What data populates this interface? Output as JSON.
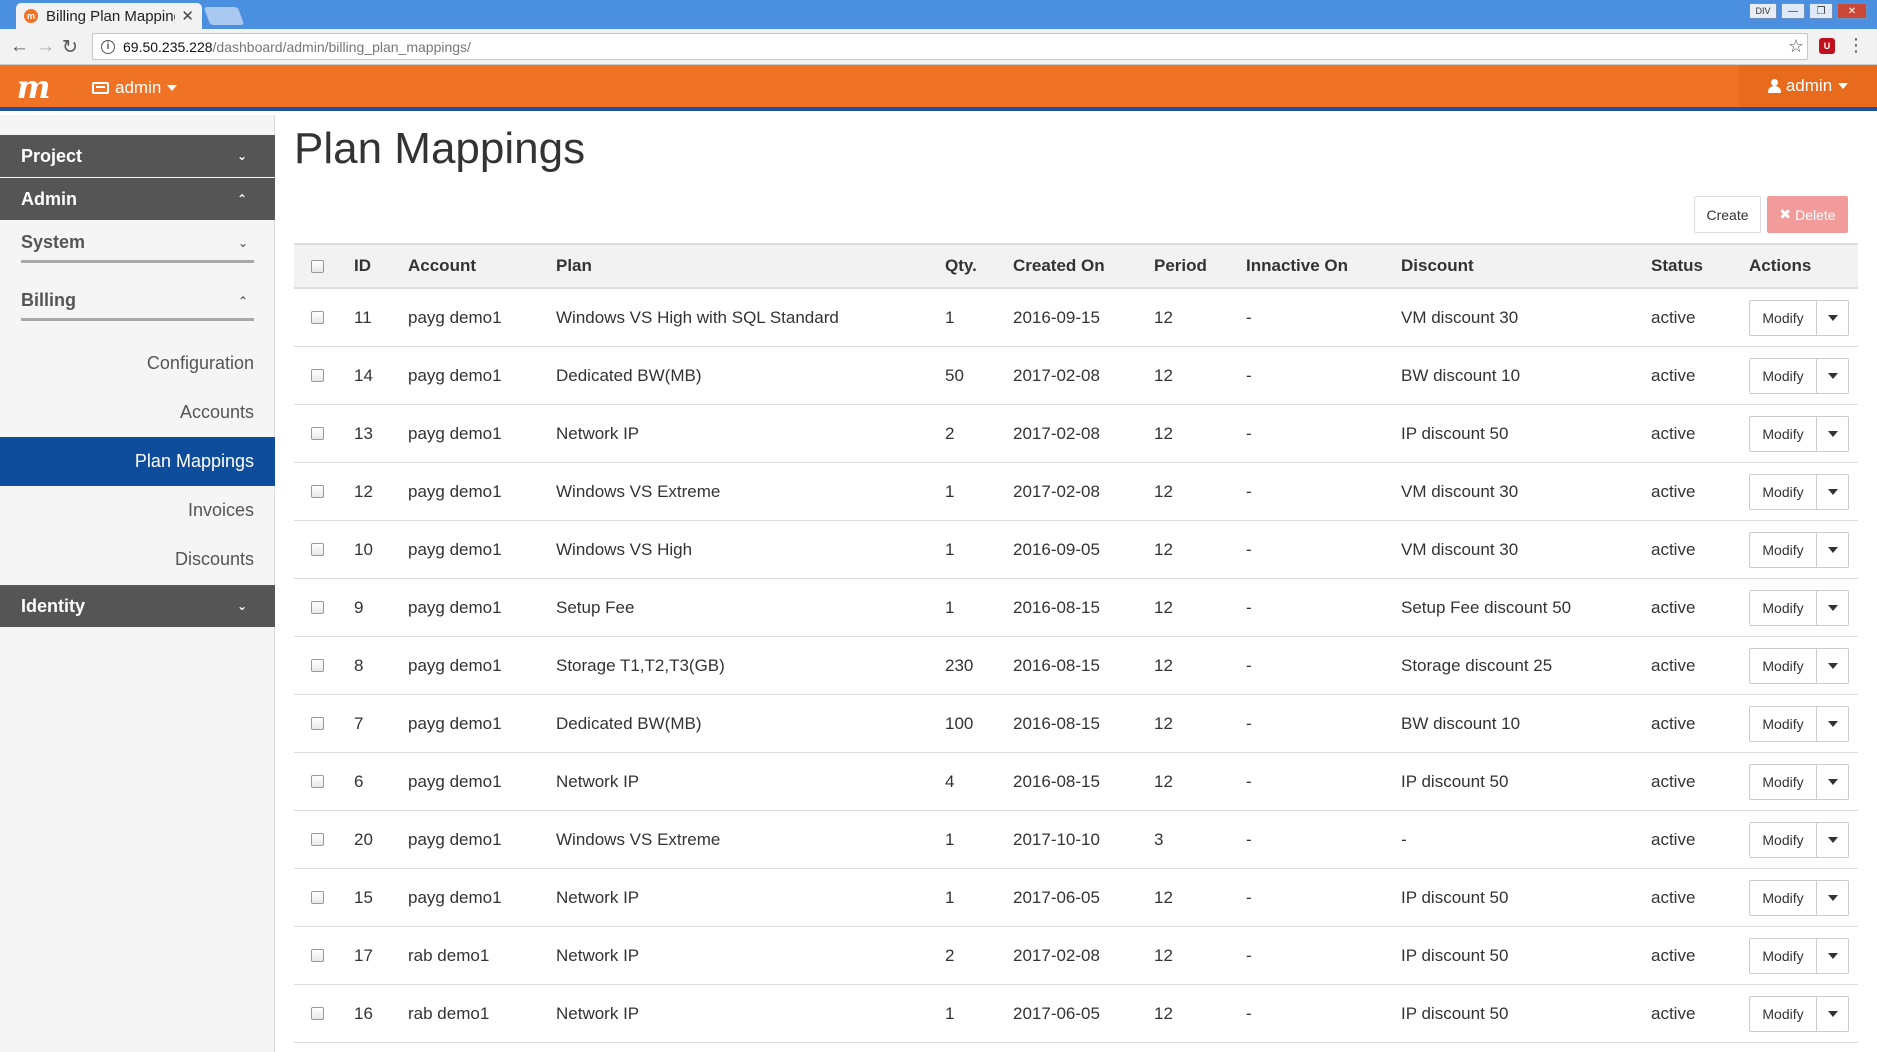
{
  "browser": {
    "tab_title": "Billing Plan Mappings",
    "tab_favicon": "m",
    "url_host": "69.50.235.228",
    "url_path": "/dashboard/admin/billing_plan_mappings/",
    "winbtn_div": "DIV",
    "ext_label": "U"
  },
  "header": {
    "logo": "m",
    "project_label": "admin",
    "user_label": "admin",
    "brand_color": "#f07224"
  },
  "sidebar": {
    "project": "Project",
    "admin": "Admin",
    "system": "System",
    "billing": "Billing",
    "items": [
      "Configuration",
      "Accounts",
      "Plan Mappings",
      "Invoices",
      "Discounts"
    ],
    "active_item": "Plan Mappings",
    "identity": "Identity"
  },
  "main": {
    "title": "Plan Mappings",
    "create_label": "Create",
    "delete_label": "Delete",
    "action_label": "Modify",
    "columns": [
      "ID",
      "Account",
      "Plan",
      "Qty.",
      "Created On",
      "Period",
      "Innactive On",
      "Discount",
      "Status",
      "Actions"
    ],
    "rows": [
      {
        "id": "11",
        "account": "payg demo1",
        "plan": "Windows VS High with SQL Standard",
        "qty": "1",
        "created": "2016-09-15",
        "period": "12",
        "inactive": "-",
        "discount": "VM discount 30",
        "status": "active"
      },
      {
        "id": "14",
        "account": "payg demo1",
        "plan": "Dedicated BW(MB)",
        "qty": "50",
        "created": "2017-02-08",
        "period": "12",
        "inactive": "-",
        "discount": "BW discount 10",
        "status": "active"
      },
      {
        "id": "13",
        "account": "payg demo1",
        "plan": "Network IP",
        "qty": "2",
        "created": "2017-02-08",
        "period": "12",
        "inactive": "-",
        "discount": "IP discount 50",
        "status": "active"
      },
      {
        "id": "12",
        "account": "payg demo1",
        "plan": "Windows VS Extreme",
        "qty": "1",
        "created": "2017-02-08",
        "period": "12",
        "inactive": "-",
        "discount": "VM discount 30",
        "status": "active"
      },
      {
        "id": "10",
        "account": "payg demo1",
        "plan": "Windows VS High",
        "qty": "1",
        "created": "2016-09-05",
        "period": "12",
        "inactive": "-",
        "discount": "VM discount 30",
        "status": "active"
      },
      {
        "id": "9",
        "account": "payg demo1",
        "plan": "Setup Fee",
        "qty": "1",
        "created": "2016-08-15",
        "period": "12",
        "inactive": "-",
        "discount": "Setup Fee discount 50",
        "status": "active"
      },
      {
        "id": "8",
        "account": "payg demo1",
        "plan": "Storage T1,T2,T3(GB)",
        "qty": "230",
        "created": "2016-08-15",
        "period": "12",
        "inactive": "-",
        "discount": "Storage discount 25",
        "status": "active"
      },
      {
        "id": "7",
        "account": "payg demo1",
        "plan": "Dedicated BW(MB)",
        "qty": "100",
        "created": "2016-08-15",
        "period": "12",
        "inactive": "-",
        "discount": "BW discount 10",
        "status": "active"
      },
      {
        "id": "6",
        "account": "payg demo1",
        "plan": "Network IP",
        "qty": "4",
        "created": "2016-08-15",
        "period": "12",
        "inactive": "-",
        "discount": "IP discount 50",
        "status": "active"
      },
      {
        "id": "20",
        "account": "payg demo1",
        "plan": "Windows VS Extreme",
        "qty": "1",
        "created": "2017-10-10",
        "period": "3",
        "inactive": "-",
        "discount": "-",
        "status": "active"
      },
      {
        "id": "15",
        "account": "payg demo1",
        "plan": "Network IP",
        "qty": "1",
        "created": "2017-06-05",
        "period": "12",
        "inactive": "-",
        "discount": "IP discount 50",
        "status": "active"
      },
      {
        "id": "17",
        "account": "rab demo1",
        "plan": "Network IP",
        "qty": "2",
        "created": "2017-02-08",
        "period": "12",
        "inactive": "-",
        "discount": "IP discount 50",
        "status": "active"
      },
      {
        "id": "16",
        "account": "rab demo1",
        "plan": "Network IP",
        "qty": "1",
        "created": "2017-06-05",
        "period": "12",
        "inactive": "-",
        "discount": "IP discount 50",
        "status": "active"
      }
    ]
  }
}
